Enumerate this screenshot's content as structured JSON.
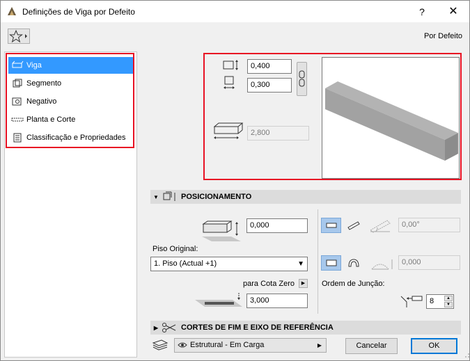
{
  "window": {
    "title": "Definições de Viga por Defeito",
    "help": "?",
    "close": "✕"
  },
  "header": {
    "preset": "Por Defeito"
  },
  "nav": {
    "items": [
      {
        "label": "Viga",
        "icon": "beam-icon"
      },
      {
        "label": "Segmento",
        "icon": "segment-icon"
      },
      {
        "label": "Negativo",
        "icon": "negative-icon"
      },
      {
        "label": "Planta e Corte",
        "icon": "floor-plan-icon"
      },
      {
        "label": "Classificação e Propriedades",
        "icon": "classification-icon"
      }
    ]
  },
  "geometry": {
    "height": "0,400",
    "width": "0,300",
    "length": "2,800"
  },
  "positioning": {
    "title": "POSICIONAMENTO",
    "offset": "0,000",
    "home_story_label": "Piso Original:",
    "home_story": "1. Piso (Actual +1)",
    "zero_label": "para Cota Zero",
    "zero_value": "3,000",
    "slant_angle": "0,00°",
    "curve_value": "0,000",
    "order_label": "Ordem de Junção:",
    "order_value": "8"
  },
  "cuts": {
    "title": "CORTES DE FIM E EIXO DE REFERÊNCIA"
  },
  "footer": {
    "layer": "Estrutural - Em Carga",
    "cancel": "Cancelar",
    "ok": "OK"
  }
}
